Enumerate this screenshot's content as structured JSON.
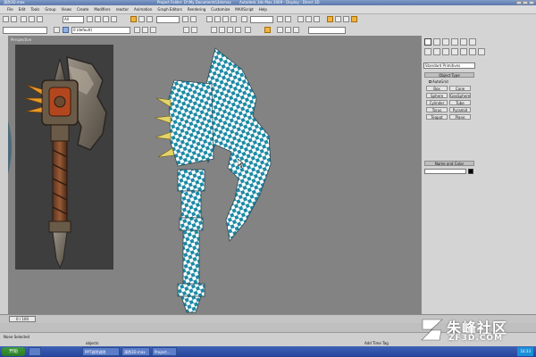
{
  "window": {
    "title_left": "漠然3D.max",
    "title_project": "Project Folder: D:\\My Documents\\3dsmax",
    "title_app": "Autodesk 3ds Max 2009 - Display : Direct 3D"
  },
  "menu": {
    "items": [
      "File",
      "Edit",
      "Tools",
      "Group",
      "Views",
      "Create",
      "Modifiers",
      "reactor",
      "Animation",
      "Graph Editors",
      "Rendering",
      "Customize",
      "MAXScript",
      "Help"
    ]
  },
  "toolbar": {
    "selection_filter": "All",
    "layer_dropdown": "0 (default)",
    "named_selection": ""
  },
  "viewport": {
    "label": "Perspective"
  },
  "command_panel": {
    "category_dropdown": "Standard Primitives",
    "object_type_title": "Object Type",
    "autogrid_label": "AutoGrid",
    "buttons": [
      "Box",
      "Cone",
      "Sphere",
      "GeoSphere",
      "Cylinder",
      "Tube",
      "Torus",
      "Pyramid",
      "Teapot",
      "Plane"
    ],
    "name_color_title": "Name and Color",
    "color_swatch": "#000000"
  },
  "timeline": {
    "frame_slider": "0 / 100"
  },
  "status": {
    "selection_text": "None Selected",
    "prompt_text": "objects",
    "add_time_tag": "Add Time Tag"
  },
  "taskbar": {
    "start_label": "开始",
    "items": [
      "",
      "PPT说明说明",
      "漠然3D.max",
      "Project..."
    ],
    "clock": "16:33"
  },
  "watermark": {
    "chinese": "朱峰社区",
    "english": "ZF3D.COM"
  }
}
